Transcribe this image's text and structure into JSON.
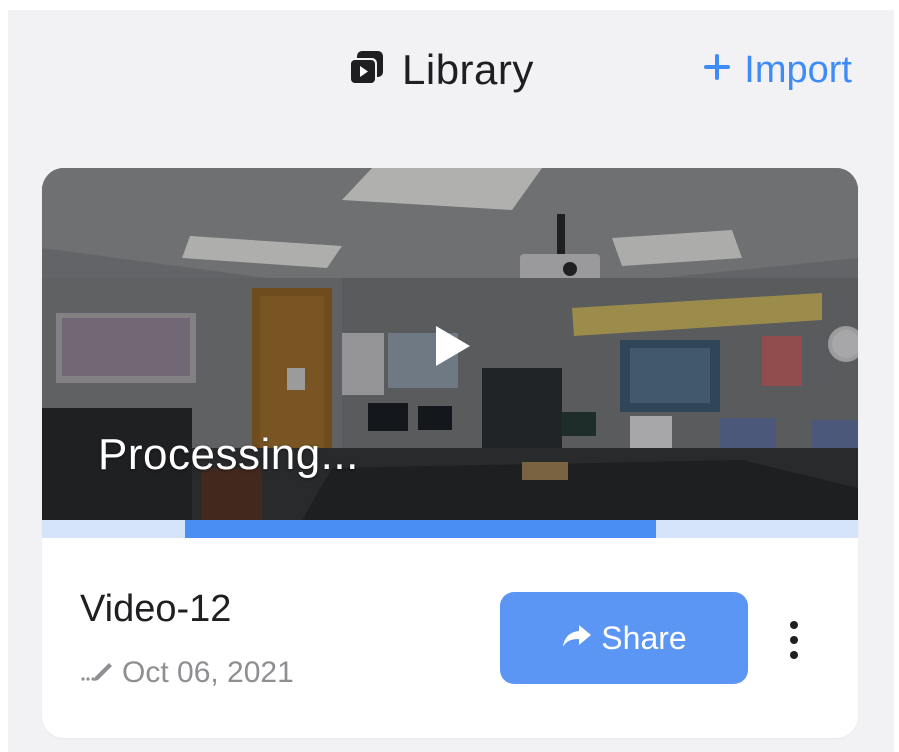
{
  "header": {
    "title": "Library",
    "title_icon": "library-stack-icon",
    "import_label": "Import",
    "import_icon": "plus-icon"
  },
  "colors": {
    "accent": "#3f8cf6",
    "share_button": "#5b96f4",
    "progress_fill": "#4a8ef3",
    "progress_track": "#d6e4fb"
  },
  "video": {
    "status": "Processing...",
    "play_icon": "play-icon",
    "progress": {
      "start": 0.175,
      "end": 0.753
    },
    "title": "Video-12",
    "date": "Oct 06, 2021",
    "date_icon": "pencil-icon",
    "share_label": "Share",
    "share_icon": "share-arrow-icon",
    "more_icon": "more-vertical-icon"
  }
}
